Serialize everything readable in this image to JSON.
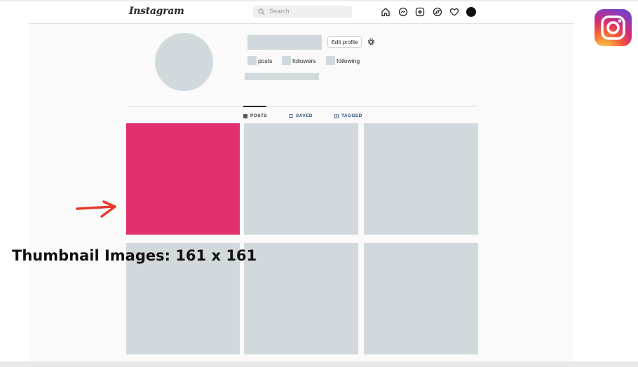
{
  "navbar": {
    "logo_text": "Instagram",
    "search_placeholder": "Search",
    "icons": [
      "home-icon",
      "messenger-icon",
      "new-post-icon",
      "explore-icon",
      "heart-icon",
      "profile-avatar"
    ]
  },
  "profile": {
    "edit_profile_label": "Edit profile",
    "stats": [
      {
        "label": "posts"
      },
      {
        "label": "followers"
      },
      {
        "label": "following"
      }
    ]
  },
  "tabs": [
    {
      "label": "POSTS",
      "icon": "grid-icon",
      "active": true
    },
    {
      "label": "SAVED",
      "icon": "bookmark-icon",
      "active": false
    },
    {
      "label": "TAGGED",
      "icon": "tag-icon",
      "active": false
    }
  ],
  "grid": {
    "tiles": [
      {
        "highlighted": true
      },
      {
        "highlighted": false
      },
      {
        "highlighted": false
      },
      {
        "highlighted": false
      },
      {
        "highlighted": false
      },
      {
        "highlighted": false
      }
    ]
  },
  "annotation": {
    "caption": "Thumbnail Images: 161 x 161",
    "arrow_color": "#e8382b"
  },
  "colors": {
    "placeholder": "#d2d9dd",
    "highlight_tile": "#e0306f",
    "tab_active": "#262626",
    "tab_inactive": "#2f4a78"
  },
  "brand_badge": "instagram-logo-icon"
}
